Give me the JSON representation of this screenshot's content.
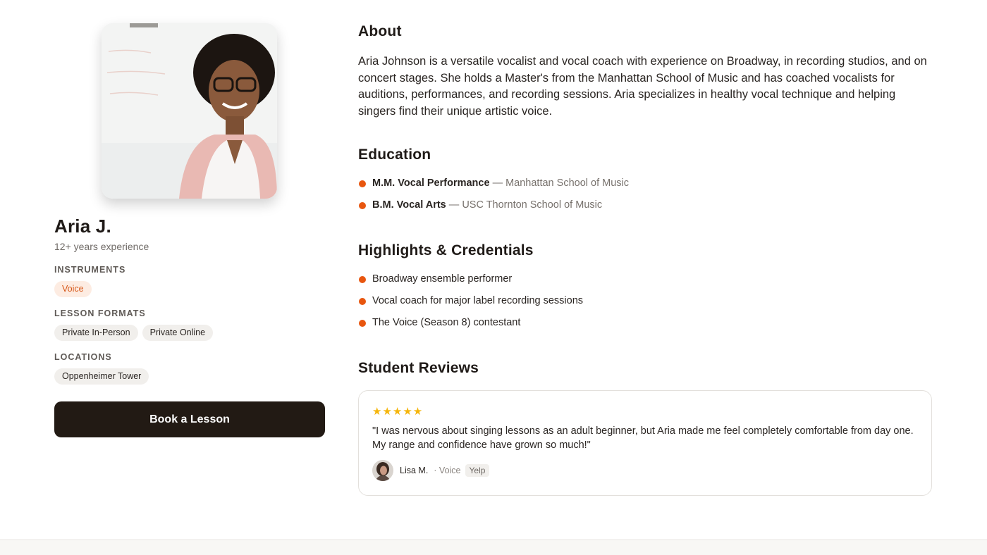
{
  "profile": {
    "name": "Aria J.",
    "experience": "12+ years experience",
    "instruments_label": "INSTRUMENTS",
    "instruments": [
      "Voice"
    ],
    "lesson_formats_label": "LESSON FORMATS",
    "lesson_formats": [
      "Private In-Person",
      "Private Online"
    ],
    "locations_label": "LOCATIONS",
    "locations": [
      "Oppenheimer Tower"
    ],
    "book_button": "Book a Lesson"
  },
  "about": {
    "heading": "About",
    "text": "Aria Johnson is a versatile vocalist and vocal coach with experience on Broadway, in recording studios, and on concert stages. She holds a Master's from the Manhattan School of Music and has coached vocalists for auditions, performances, and recording sessions. Aria specializes in healthy vocal technique and helping singers find their unique artistic voice."
  },
  "education": {
    "heading": "Education",
    "separator": "—",
    "items": [
      {
        "degree": "M.M. Vocal Performance",
        "school": "Manhattan School of Music"
      },
      {
        "degree": "B.M. Vocal Arts",
        "school": "USC Thornton School of Music"
      }
    ]
  },
  "highlights": {
    "heading": "Highlights & Credentials",
    "items": [
      "Broadway ensemble performer",
      "Vocal coach for major label recording sessions",
      "The Voice (Season 8) contestant"
    ]
  },
  "reviews": {
    "heading": "Student Reviews",
    "items": [
      {
        "stars": "★★★★★",
        "rating": 5,
        "text": "\"I was nervous about singing lessons as an adult beginner, but Aria made me feel completely comfortable from day one. My range and confidence have grown so much!\"",
        "reviewer": "Lisa M.",
        "meta": "· Voice",
        "source": "Yelp"
      }
    ]
  },
  "colors": {
    "accent": "#e8560f",
    "button": "#221a14",
    "star": "#f5b50a"
  },
  "icons": {
    "bullet": "orange-dot-icon",
    "star": "star-icon"
  }
}
